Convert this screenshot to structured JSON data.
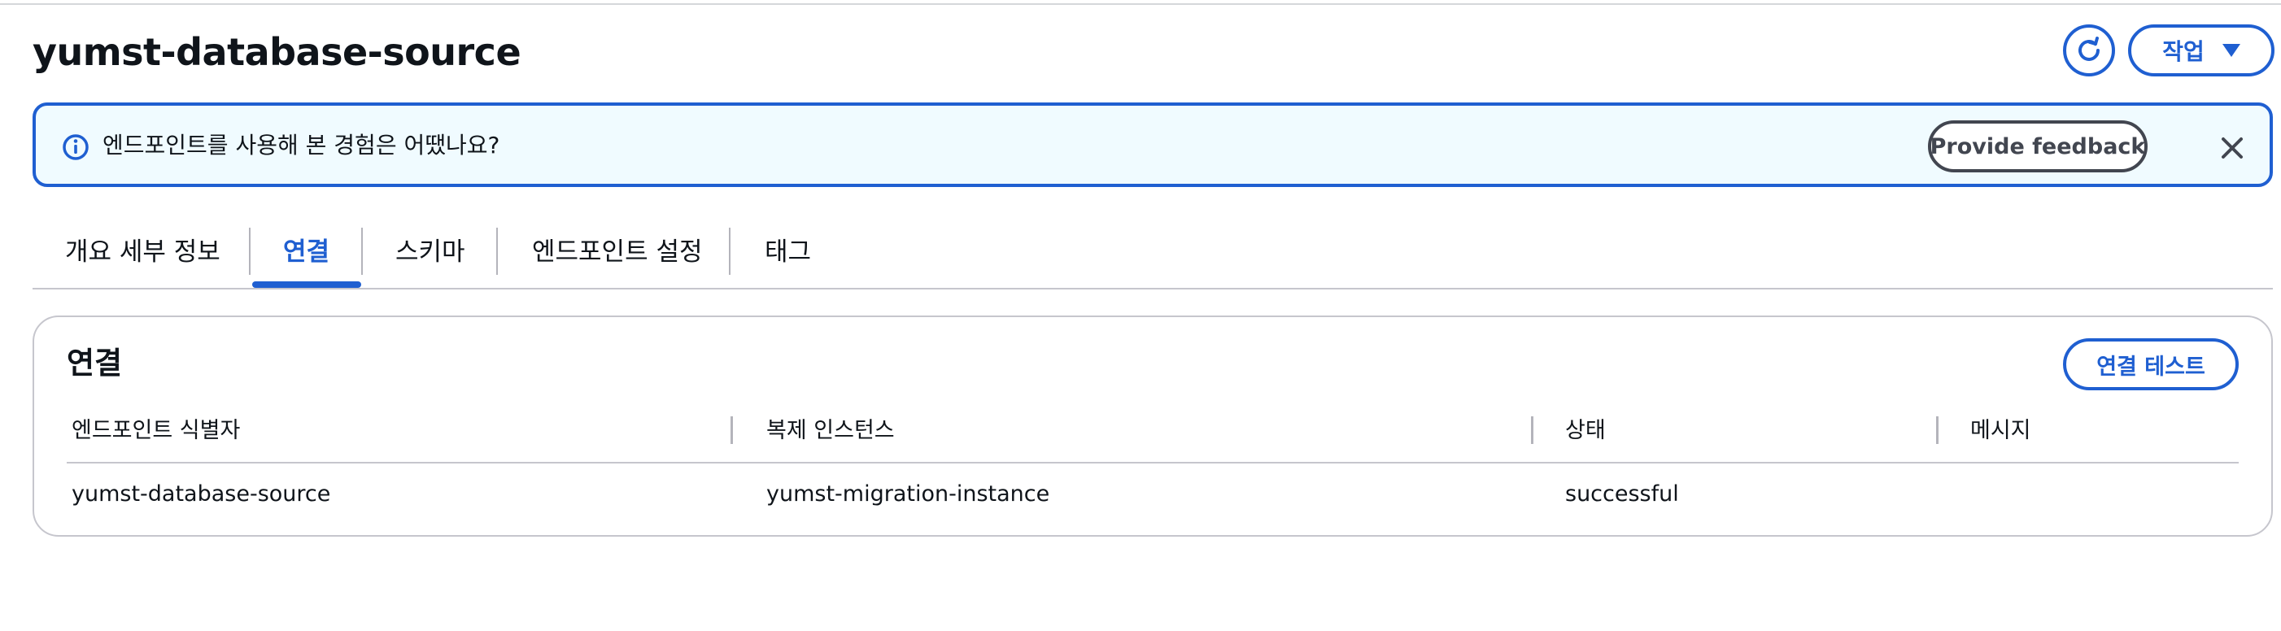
{
  "header": {
    "title": "yumst-database-source",
    "refresh_icon": "refresh-icon",
    "actions_label": "작업",
    "actions_icon": "caret-down-icon"
  },
  "flash": {
    "icon": "info-icon",
    "message": "엔드포인트를 사용해 본 경험은 어땠나요?",
    "feedback_label": "Provide feedback",
    "close_icon": "close-icon"
  },
  "tabs": [
    {
      "label": "개요 세부 정보",
      "active": false
    },
    {
      "label": "연결",
      "active": true
    },
    {
      "label": "스키마",
      "active": false
    },
    {
      "label": "엔드포인트 설정",
      "active": false
    },
    {
      "label": "태그",
      "active": false
    }
  ],
  "connections": {
    "title": "연결",
    "test_label": "연결 테스트",
    "columns": [
      "엔드포인트 식별자",
      "복제 인스턴스",
      "상태",
      "메시지"
    ],
    "rows": [
      [
        "yumst-database-source",
        "yumst-migration-instance",
        "successful",
        ""
      ]
    ]
  },
  "colors": {
    "accent": "#1f5fd1",
    "flash_bg": "#f0fbff",
    "text": "#0f141a",
    "border": "#c6c6cd"
  }
}
